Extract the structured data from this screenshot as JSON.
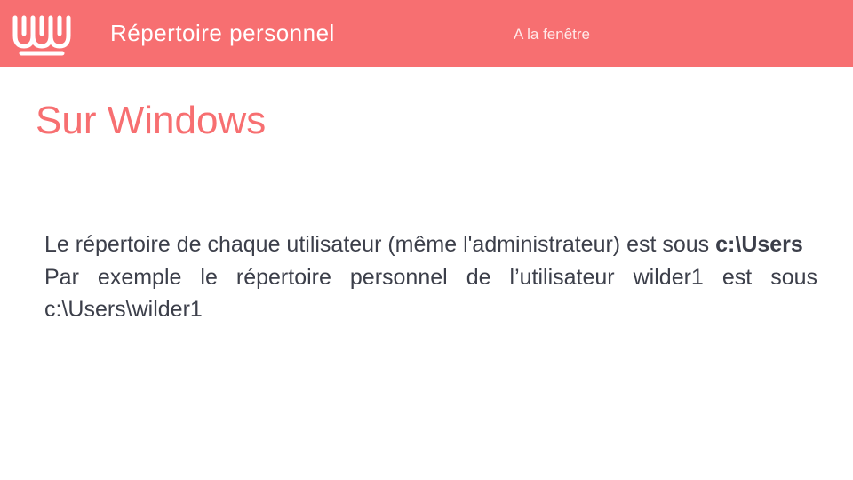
{
  "header": {
    "title": "Répertoire personnel",
    "subtitle": "A la fenêtre",
    "logo_icon": "wild-code-school-logo-icon",
    "background_color": "#f76f71"
  },
  "slide": {
    "title": "Sur Windows",
    "title_color": "#f76f71",
    "paragraph1_text": "Le répertoire de chaque utilisateur (même l'administrateur) est sous ",
    "paragraph1_path": "c:\\Users",
    "paragraph2_text": "Par exemple le répertoire personnel de l’utilisateur wilder1 est sous c:\\Users\\wilder1"
  }
}
